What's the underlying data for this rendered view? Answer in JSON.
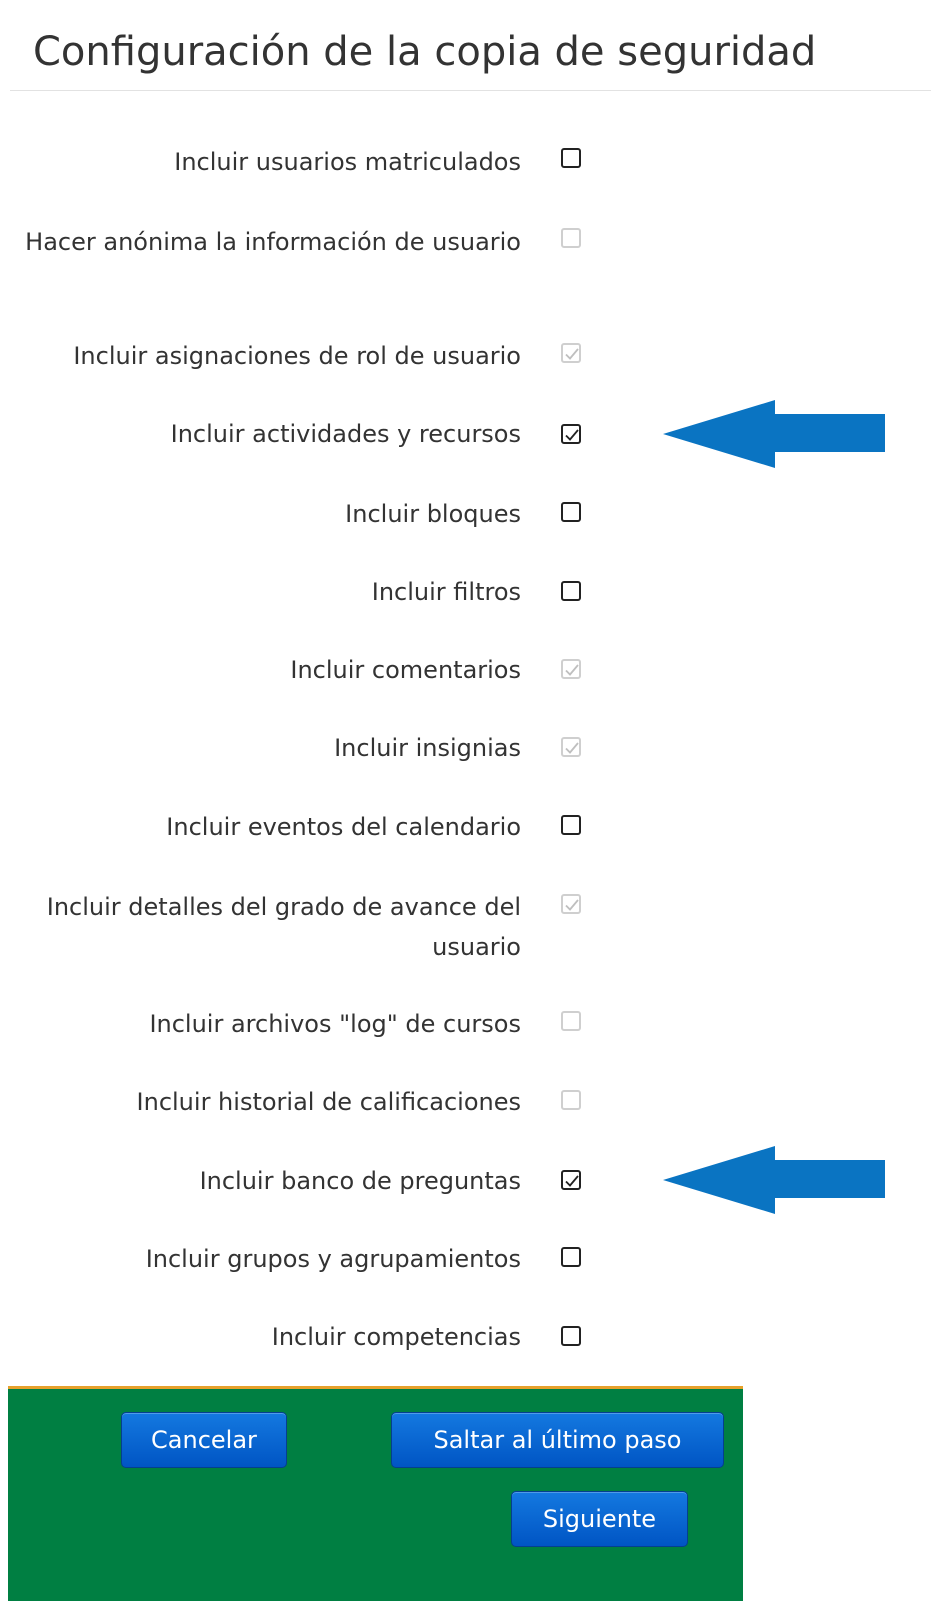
{
  "page": {
    "title": "Configuración de la copia de seguridad"
  },
  "options": [
    {
      "label": "Incluir usuarios matriculados",
      "checked": false,
      "disabled": false
    },
    {
      "label": "Hacer anónima la información de usuario",
      "checked": false,
      "disabled": true
    },
    {
      "label": "Incluir asignaciones de rol de usuario",
      "checked": true,
      "disabled": true
    },
    {
      "label": "Incluir actividades y recursos",
      "checked": true,
      "disabled": false
    },
    {
      "label": "Incluir bloques",
      "checked": false,
      "disabled": false
    },
    {
      "label": "Incluir filtros",
      "checked": false,
      "disabled": false
    },
    {
      "label": "Incluir comentarios",
      "checked": true,
      "disabled": true
    },
    {
      "label": "Incluir insignias",
      "checked": true,
      "disabled": true
    },
    {
      "label": "Incluir eventos del calendario",
      "checked": false,
      "disabled": false
    },
    {
      "label": "Incluir detalles del grado de avance del usuario",
      "checked": true,
      "disabled": true
    },
    {
      "label": "Incluir archivos \"log\" de cursos",
      "checked": false,
      "disabled": true
    },
    {
      "label": "Incluir historial de calificaciones",
      "checked": false,
      "disabled": true
    },
    {
      "label": "Incluir banco de preguntas",
      "checked": true,
      "disabled": false
    },
    {
      "label": "Incluir grupos y agrupamientos",
      "checked": false,
      "disabled": false
    },
    {
      "label": "Incluir competencias",
      "checked": false,
      "disabled": false
    }
  ],
  "buttons": {
    "cancel": "Cancelar",
    "skip_to_last": "Saltar al último paso",
    "next": "Siguiente"
  },
  "colors": {
    "footer_bg": "#007f42",
    "footer_border": "#e6a12c",
    "button_blue": "#0a66d6",
    "annotation_arrow": "#0a74c2"
  },
  "annotations": [
    {
      "name": "annotation-arrow",
      "points_to": "Incluir actividades y recursos"
    },
    {
      "name": "annotation-arrow",
      "points_to": "Incluir banco de preguntas"
    }
  ]
}
